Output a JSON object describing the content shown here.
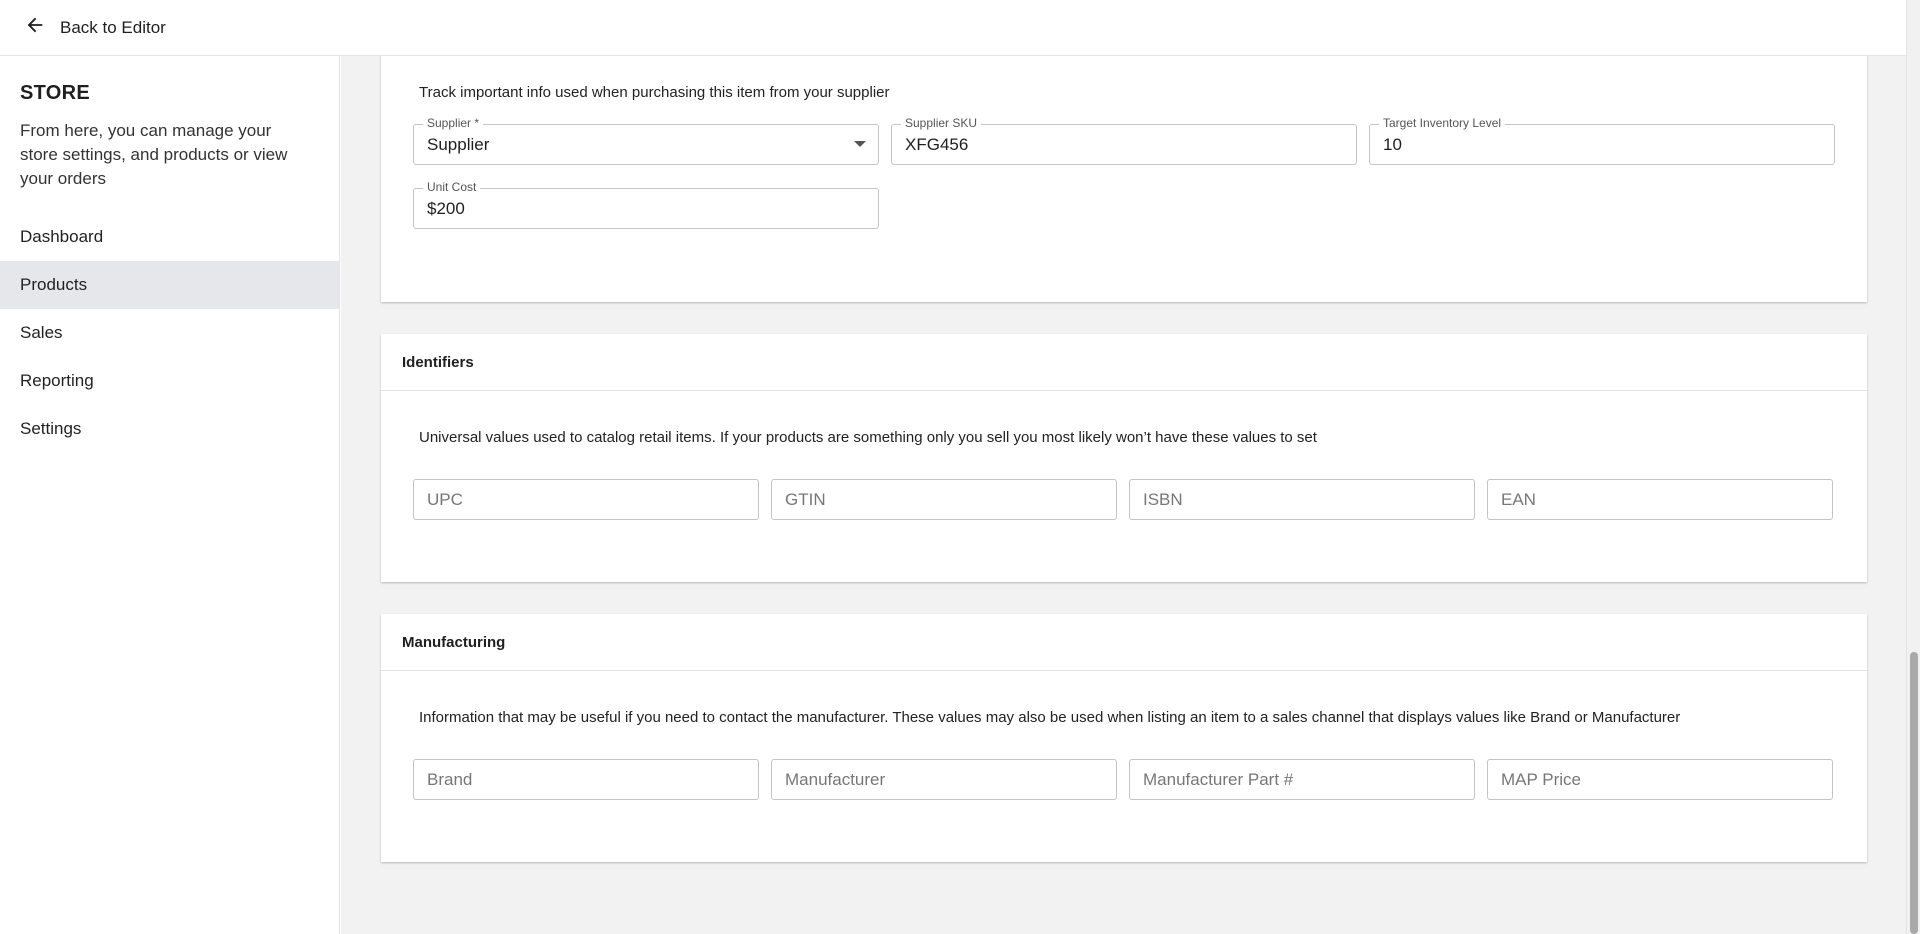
{
  "topbar": {
    "back_label": "Back to Editor",
    "back_icon": "arrow-left-icon"
  },
  "sidebar": {
    "title": "STORE",
    "description": "From here, you can manage your store settings, and products or view your orders",
    "items": [
      {
        "label": "Dashboard",
        "active": false
      },
      {
        "label": "Products",
        "active": true
      },
      {
        "label": "Sales",
        "active": false
      },
      {
        "label": "Reporting",
        "active": false
      },
      {
        "label": "Settings",
        "active": false
      }
    ]
  },
  "purchasing": {
    "description": "Track important info used when purchasing this item from your supplier",
    "supplier": {
      "label": "Supplier *",
      "value": "Supplier"
    },
    "supplier_sku": {
      "label": "Supplier SKU",
      "value": "XFG456"
    },
    "target_inventory": {
      "label": "Target Inventory Level",
      "value": "10"
    },
    "unit_cost": {
      "label": "Unit Cost",
      "value": "$200"
    }
  },
  "identifiers": {
    "title": "Identifiers",
    "description": "Universal values used to catalog retail items. If your products are something only you sell you most likely won’t have these values to set",
    "fields": [
      {
        "placeholder": "UPC"
      },
      {
        "placeholder": "GTIN"
      },
      {
        "placeholder": "ISBN"
      },
      {
        "placeholder": "EAN"
      }
    ]
  },
  "manufacturing": {
    "title": "Manufacturing",
    "description": "Information that may be useful if you need to contact the manufacturer. These values may also be used when listing an item to a sales channel that displays values like Brand or Manufacturer",
    "fields": [
      {
        "placeholder": "Brand"
      },
      {
        "placeholder": "Manufacturer"
      },
      {
        "placeholder": "Manufacturer Part #"
      },
      {
        "placeholder": "MAP Price"
      }
    ]
  }
}
